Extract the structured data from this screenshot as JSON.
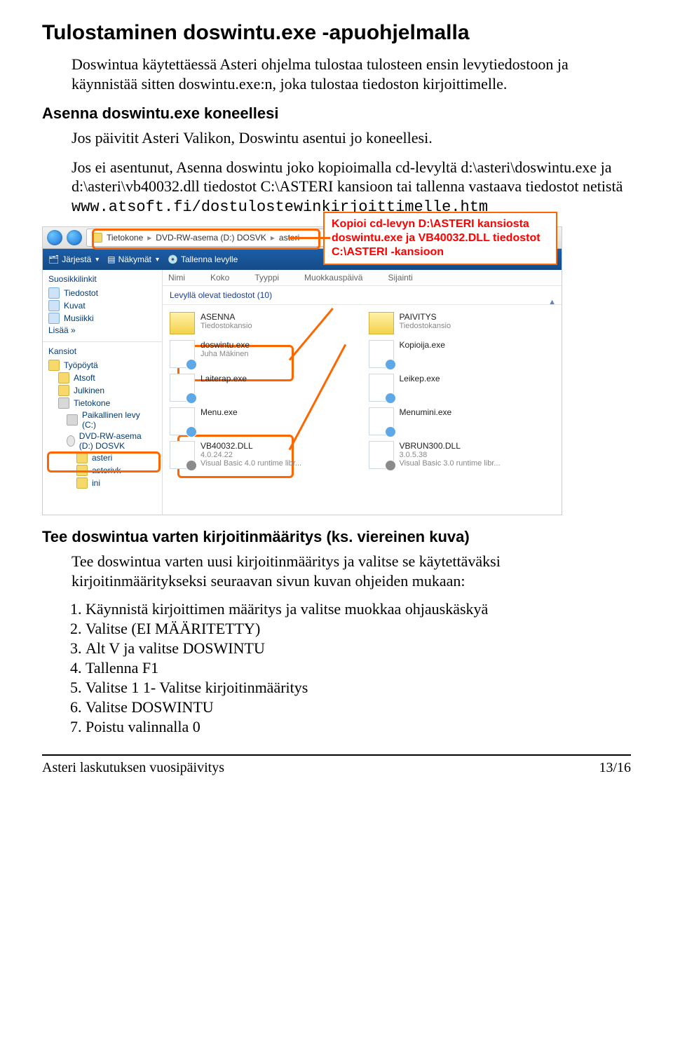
{
  "title": "Tulostaminen doswintu.exe -apuohjelmalla",
  "intro": "Doswintua käytettäessä Asteri ohjelma tulostaa tulosteen ensin levytiedostoon ja käynnistää sitten doswintu.exe:n, joka tulostaa tiedoston kirjoittimelle.",
  "sub1": "Asenna doswintu.exe koneellesi",
  "sub1_body": [
    "Jos päivitit Asteri Valikon, Doswintu asentui jo koneellesi.",
    "Jos ei asentunut, Asenna doswintu joko kopioimalla cd-levyltä d:\\asteri\\doswintu.exe ja d:\\asteri\\vb40032.dll tiedostot C:\\ASTERI kansioon tai tallenna vastaava tiedostot netistä "
  ],
  "url": "www.atsoft.fi/dostulostewinkirjoittimelle.htm",
  "callout": "Kopioi cd-levyn D:\\ASTERI kansiosta doswintu.exe ja VB40032.DLL tiedostot C:\\ASTERI -kansioon",
  "shot": {
    "breadcrumb": [
      "Tietokone",
      "DVD-RW-asema (D:) DOSVK",
      "asteri"
    ],
    "cmdbar": {
      "jarjesta": "Järjestä",
      "nakymat": "Näkymät",
      "tallenna": "Tallenna levylle"
    },
    "left": {
      "suosikki": "Suosikkilinkit",
      "items_fav": [
        "Tiedostot",
        "Kuvat",
        "Musiikki",
        "Lisää »"
      ],
      "kansiot": "Kansiot",
      "tree": [
        "Työpöytä",
        "Atsoft",
        "Julkinen",
        "Tietokone",
        "Paikallinen levy (C:)",
        "DVD-RW-asema (D:) DOSVK",
        "asteri",
        "asterivk",
        "ini"
      ]
    },
    "columns": [
      "Nimi",
      "Koko",
      "Tyyppi",
      "Muokkauspäivä",
      "Sijainti"
    ],
    "group": "Levyllä olevat tiedostot (10)",
    "files": [
      [
        "ASENNA",
        "Tiedostokansio",
        "folder"
      ],
      [
        "PAIVITYS",
        "Tiedostokansio",
        "folder"
      ],
      [
        "doswintu.exe",
        "Juha Mäkinen",
        "exe"
      ],
      [
        "Kopioija.exe",
        "",
        "exe"
      ],
      [
        "Laiterap.exe",
        "",
        "exe"
      ],
      [
        "Leikep.exe",
        "",
        "exe"
      ],
      [
        "Menu.exe",
        "",
        "exe"
      ],
      [
        "Menumini.exe",
        "",
        "exe"
      ],
      [
        "VB40032.DLL",
        "4.0.24.22\nVisual Basic 4.0 runtime libr...",
        "dll"
      ],
      [
        "VBRUN300.DLL",
        "3.0.5.38\nVisual Basic 3.0 runtime libr...",
        "dll"
      ]
    ]
  },
  "sub2": "Tee doswintua varten kirjoitinmääritys (ks. viereinen kuva)",
  "sub2_body": "Tee doswintua varten uusi kirjoitinmääritys ja valitse se käytettäväksi kirjoitinmääritykseksi seuraavan sivun kuvan ohjeiden mukaan:",
  "steps": [
    "Käynnistä kirjoittimen määritys ja valitse muokkaa ohjauskäskyä",
    "Valitse (EI MÄÄRITETTY)",
    "Alt V ja valitse DOSWINTU",
    "Tallenna F1",
    "Valitse 1 1- Valitse kirjoitinmääritys",
    "Valitse DOSWINTU",
    "Poistu valinnalla 0"
  ],
  "footer": {
    "left": "Asteri laskutuksen vuosipäivitys",
    "right": "13/16"
  }
}
